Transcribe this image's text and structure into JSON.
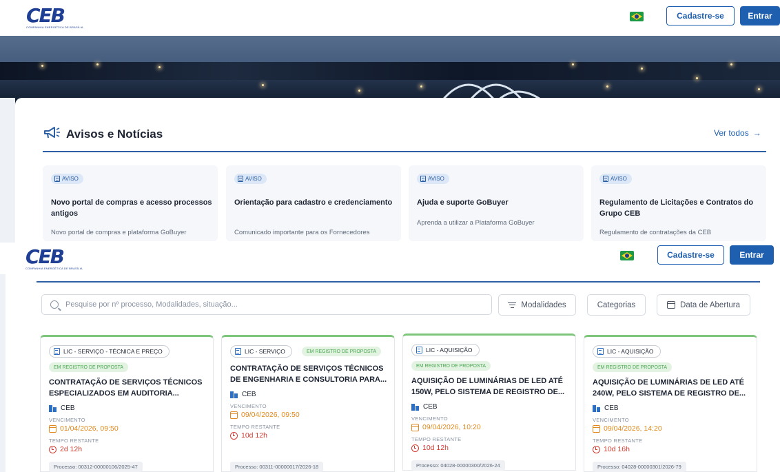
{
  "header": {
    "logo_text": "CEB",
    "logo_subtitle": "COMPANHIA ENERGÉTICA DE BRASÍLIA",
    "register_label": "Cadastre-se",
    "login_label": "Entrar"
  },
  "news": {
    "title": "Avisos e Notícias",
    "see_all": "Ver todos",
    "items": [
      {
        "badge": "AVISO",
        "title": "Novo portal de compras e acesso processos antigos",
        "description": "Novo portal de compras e plataforma GoBuyer"
      },
      {
        "badge": "AVISO",
        "title": "Orientação para cadastro e credenciamento",
        "description": "Comunicado importante para os Fornecedores"
      },
      {
        "badge": "AVISO",
        "title": "Ajuda e suporte GoBuyer",
        "description": "Aprenda a utilizar a Plataforma GoBuyer"
      },
      {
        "badge": "AVISO",
        "title": "Regulamento de Licitações e Contratos do Grupo CEB",
        "description": "Regulamento de contratações da CEB"
      }
    ]
  },
  "search": {
    "placeholder": "Pesquise por nº processo, Modalidades, situação...",
    "filters": {
      "modalidades": "Modalidades",
      "categorias": "Categorias",
      "data_abertura": "Data de Abertura"
    }
  },
  "labels": {
    "vencimento": "VENCIMENTO",
    "tempo_restante": "TEMPO RESTANTE"
  },
  "processes": [
    {
      "tag": "LIC - SERVIÇO - TÉCNICA E PREÇO",
      "status": "EM REGISTRO DE PROPOSTA",
      "title": "CONTRATAÇÃO DE SERVIÇOS TÉCNICOS ESPECIALIZADOS EM AUDITORIA...",
      "org": "CEB",
      "due": "01/04/2026, 09:50",
      "remaining": "2d 12h",
      "process": "Processo: 00312-00000106/2025-47"
    },
    {
      "tag": "LIC - SERVIÇO",
      "status": "EM REGISTRO DE PROPOSTA",
      "title": "CONTRATAÇÃO DE SERVIÇOS TÉCNICOS DE ENGENHARIA E CONSULTORIA PARA...",
      "org": "CEB",
      "due": "09/04/2026, 09:50",
      "remaining": "10d 12h",
      "process": "Processo: 00311-00000017/2026-18"
    },
    {
      "tag": "LIC - AQUISIÇÃO",
      "status": "EM REGISTRO DE PROPOSTA",
      "title": "AQUISIÇÃO DE LUMINÁRIAS DE LED ATÉ 150W, PELO SISTEMA DE REGISTRO DE...",
      "org": "CEB",
      "due": "09/04/2026, 10:20",
      "remaining": "10d 12h",
      "process": "Processo: 04028-00000300/2026-24"
    },
    {
      "tag": "LIC - AQUISIÇÃO",
      "status": "EM REGISTRO DE PROPOSTA",
      "title": "AQUISIÇÃO DE LUMINÁRIAS DE LED ATÉ 240W, PELO SISTEMA DE REGISTRO DE...",
      "org": "CEB",
      "due": "09/04/2026, 14:20",
      "remaining": "10d 16h",
      "process": "Processo: 04028-00000301/2026-79"
    }
  ],
  "icons": {
    "megaphone": "megaphone-icon",
    "arrow": "arrow-right-icon",
    "flag": "brazil-flag-icon",
    "document": "document-icon",
    "building": "building-icon",
    "calendar": "calendar-icon",
    "clock": "clock-icon",
    "search": "search-icon",
    "filter": "filter-lines-icon"
  },
  "colors": {
    "primary": "#1f5fb0",
    "status_green": "#4aa650",
    "card_top": "#7cc57a",
    "due_orange": "#e08a1e",
    "remaining_red": "#d33b2f"
  }
}
